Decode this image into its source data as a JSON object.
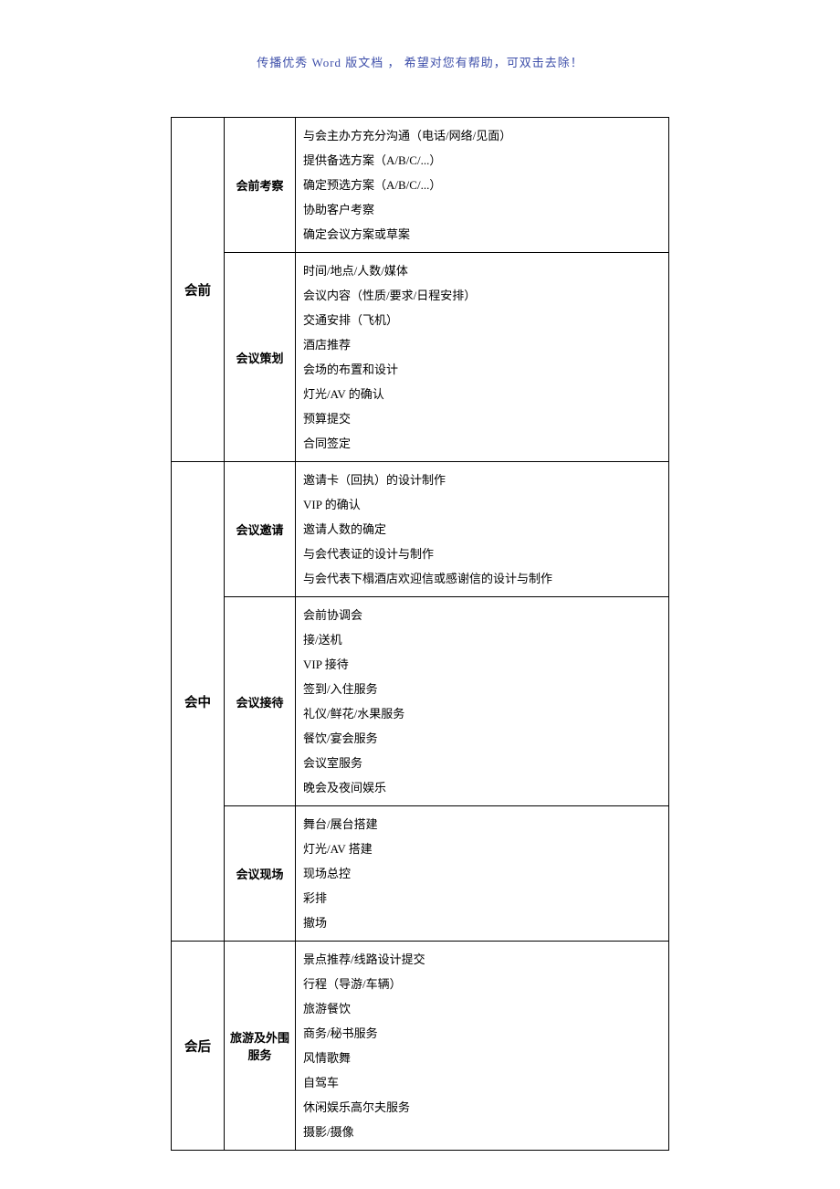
{
  "header": "传播优秀 Word 版文档 ， 希望对您有帮助，可双击去除！",
  "sections": [
    {
      "phase": "会前",
      "groups": [
        {
          "category": "会前考察",
          "items": [
            "与会主办方充分沟通（电话/网络/见面）",
            "提供备选方案（A/B/C/...）",
            "确定预选方案（A/B/C/...）",
            "协助客户考察",
            "确定会议方案或草案"
          ]
        },
        {
          "category": "会议策划",
          "items": [
            "时间/地点/人数/媒体",
            "会议内容（性质/要求/日程安排）",
            "交通安排（飞机）",
            "酒店推荐",
            "会场的布置和设计",
            "灯光/AV 的确认",
            "预算提交",
            "合同签定"
          ]
        }
      ]
    },
    {
      "phase": "会中",
      "groups": [
        {
          "category": "会议邀请",
          "items": [
            "邀请卡（回执）的设计制作",
            "VIP 的确认",
            "邀请人数的确定",
            "与会代表证的设计与制作",
            "与会代表下榻酒店欢迎信或感谢信的设计与制作"
          ]
        },
        {
          "category": "会议接待",
          "items": [
            "会前协调会",
            "接/送机",
            "VIP 接待",
            "签到/入住服务",
            "礼仪/鲜花/水果服务",
            "餐饮/宴会服务",
            "会议室服务",
            "晚会及夜间娱乐"
          ]
        },
        {
          "category": "会议现场",
          "items": [
            "舞台/展台搭建",
            "灯光/AV 搭建",
            "现场总控",
            "彩排",
            "撤场"
          ]
        }
      ]
    },
    {
      "phase": "会后",
      "groups": [
        {
          "category": "旅游及外围服务",
          "items": [
            "景点推荐/线路设计提交",
            "行程（导游/车辆）",
            "旅游餐饮",
            "商务/秘书服务",
            "风情歌舞",
            "自驾车",
            "休闲娱乐高尔夫服务",
            "摄影/摄像"
          ]
        }
      ]
    }
  ]
}
